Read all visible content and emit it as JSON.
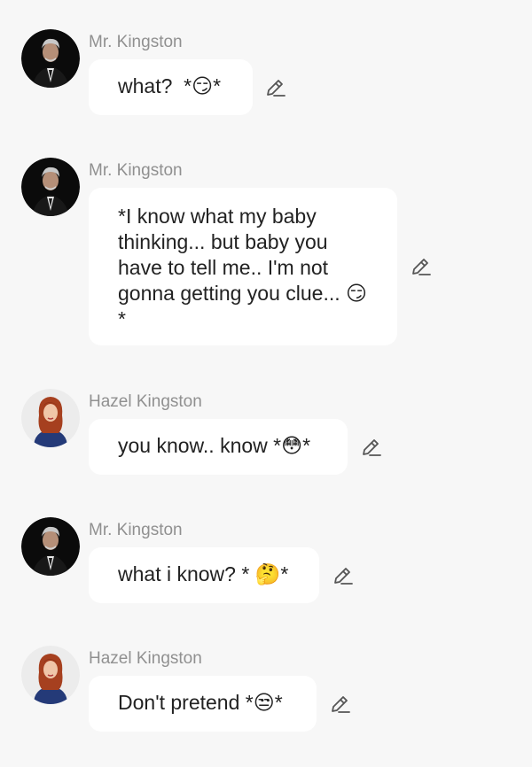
{
  "messages": [
    {
      "sender": "Mr. Kingston",
      "avatar": "mr-kingston-avatar",
      "text": "what?  *😏*",
      "edit_icon": "pencil-icon"
    },
    {
      "sender": "Mr. Kingston",
      "avatar": "mr-kingston-avatar",
      "text": "*I know what my baby thinking... but baby you have to tell me.. I'm not gonna getting you clue... 😏*",
      "edit_icon": "pencil-icon"
    },
    {
      "sender": "Hazel Kingston",
      "avatar": "hazel-kingston-avatar",
      "text": "you know.. know *😳*",
      "edit_icon": "pencil-icon"
    },
    {
      "sender": "Mr. Kingston",
      "avatar": "mr-kingston-avatar",
      "text": "what i know? * 🤔*",
      "edit_icon": "pencil-icon"
    },
    {
      "sender": "Hazel Kingston",
      "avatar": "hazel-kingston-avatar",
      "text": "Don't pretend *😒*",
      "edit_icon": "pencil-icon"
    }
  ],
  "colors": {
    "background": "#f7f7f7",
    "bubble": "#ffffff",
    "sender_text": "#909090",
    "message_text": "#222222",
    "icon": "#555555"
  }
}
